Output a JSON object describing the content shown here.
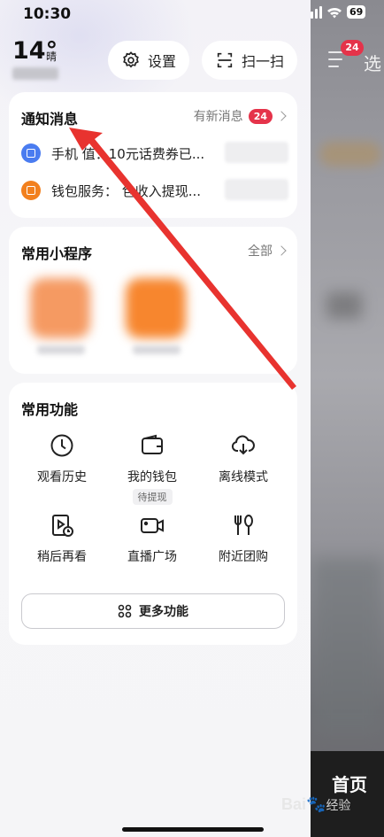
{
  "status_bar": {
    "time": "10:30",
    "battery": "69"
  },
  "weather": {
    "temperature": "14°",
    "condition": "晴"
  },
  "top_buttons": {
    "settings_label": "设置",
    "scan_label": "扫一扫"
  },
  "notifications": {
    "title": "通知消息",
    "new_label": "有新消息",
    "count": "24",
    "items": [
      {
        "text": "手机  值：10元话费券已..."
      },
      {
        "text": "钱包服务：  包收入提现..."
      }
    ]
  },
  "mini_programs": {
    "title": "常用小程序",
    "all_label": "全部"
  },
  "functions": {
    "title": "常用功能",
    "items": [
      {
        "label": "观看历史",
        "icon": "clock-icon"
      },
      {
        "label": "我的钱包",
        "icon": "wallet-icon",
        "tag": "待提现"
      },
      {
        "label": "离线模式",
        "icon": "cloud-download-icon"
      },
      {
        "label": "稍后再看",
        "icon": "watch-later-icon"
      },
      {
        "label": "直播广场",
        "icon": "live-camera-icon"
      },
      {
        "label": "附近团购",
        "icon": "fork-spoon-icon"
      }
    ],
    "more_label": "更多功能"
  },
  "background_app": {
    "badge": "24",
    "select_text": "选",
    "home_tab": "首页"
  },
  "watermark": {
    "brand": "Bai",
    "suffix": "经验"
  },
  "colors": {
    "accent_red": "#e5334a",
    "arrow_red": "#e8332f"
  }
}
